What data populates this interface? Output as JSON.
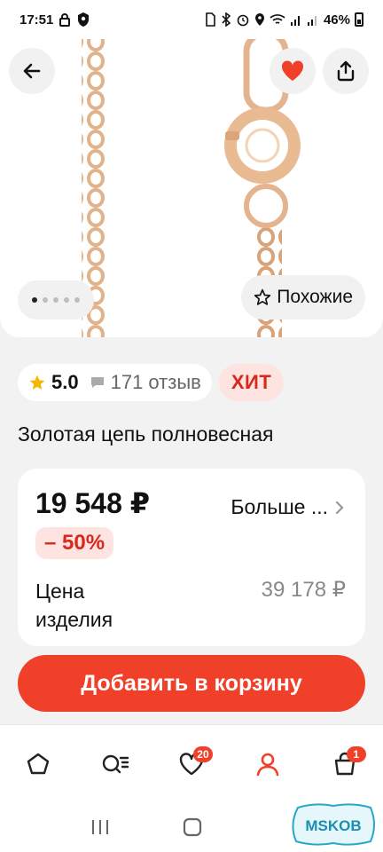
{
  "status_bar": {
    "time": "17:51",
    "battery": "46%"
  },
  "hero": {
    "back_icon": "arrow-left-icon",
    "favorite_icon": "heart-icon",
    "share_icon": "share-icon",
    "slide_count": 5,
    "active_slide": 1,
    "similar_label": "Похожие"
  },
  "rating": {
    "score": "5.0",
    "reviews": "171 отзыв",
    "badge": "ХИТ"
  },
  "product": {
    "title": "Золотая цепь полновесная"
  },
  "price_card": {
    "price": "19 548 ₽",
    "more_label": "Больше ...",
    "discount": "– 50%",
    "item_price_label": "Цена изделия",
    "item_price_value": "39 178 ₽"
  },
  "actions": {
    "add_to_cart": "Добавить в корзину"
  },
  "bottom_nav": {
    "items": [
      {
        "name": "home",
        "icon": "home-icon"
      },
      {
        "name": "catalog",
        "icon": "search-catalog-icon"
      },
      {
        "name": "favorites",
        "icon": "heart-icon",
        "badge": "20"
      },
      {
        "name": "profile",
        "icon": "profile-icon"
      },
      {
        "name": "cart",
        "icon": "bag-icon",
        "badge": "1"
      }
    ]
  },
  "watermark": {
    "text": "MSKOB"
  },
  "colors": {
    "accent": "#f0402a",
    "badge_bg": "#fde4e0",
    "badge_text": "#d8281d",
    "gold": "#e3b48f",
    "star": "#f5b800"
  }
}
